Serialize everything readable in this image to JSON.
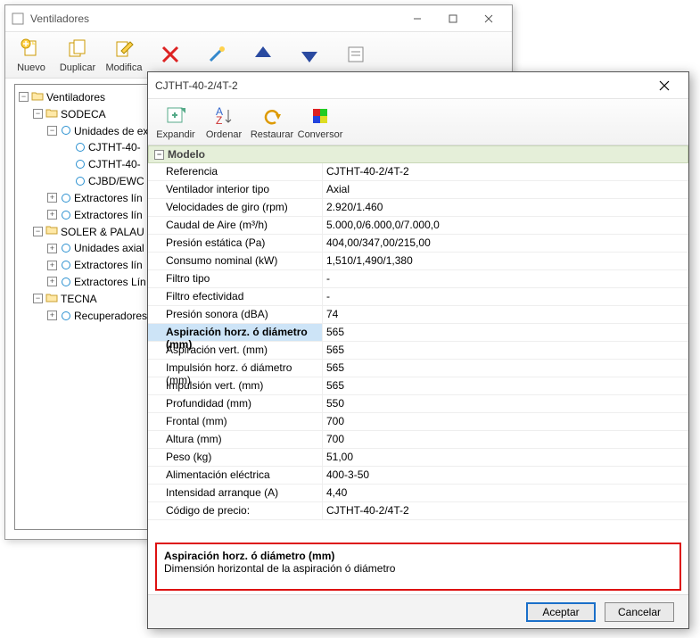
{
  "main_window": {
    "title": "Ventiladores",
    "toolbar": [
      {
        "label": "Nuevo",
        "icon": "new"
      },
      {
        "label": "Duplicar",
        "icon": "duplicate"
      },
      {
        "label": "Modifica",
        "icon": "edit"
      },
      {
        "label": "",
        "icon": "delete"
      },
      {
        "label": "",
        "icon": "wizard"
      },
      {
        "label": "",
        "icon": "up"
      },
      {
        "label": "",
        "icon": "down"
      },
      {
        "label": "",
        "icon": "form"
      }
    ]
  },
  "tree": {
    "root": "Ventiladores",
    "nodes": [
      {
        "label": "SODECA",
        "expanded": true,
        "children": [
          {
            "label": "Unidades de ex",
            "expanded": true,
            "circle": true,
            "children": [
              {
                "label": "CJTHT-40-",
                "circle": true
              },
              {
                "label": "CJTHT-40-",
                "circle": true
              },
              {
                "label": "CJBD/EWC",
                "circle": true
              }
            ]
          },
          {
            "label": "Extractores lín",
            "circle": true,
            "expandable": true
          },
          {
            "label": "Extractores lín",
            "circle": true,
            "expandable": true
          }
        ]
      },
      {
        "label": "SOLER & PALAU",
        "expanded": true,
        "children": [
          {
            "label": "Unidades axial",
            "circle": true,
            "expandable": true
          },
          {
            "label": "Extractores lín",
            "circle": true,
            "expandable": true
          },
          {
            "label": "Extractores Lín",
            "circle": true,
            "expandable": true
          }
        ]
      },
      {
        "label": "TECNA",
        "expanded": true,
        "children": [
          {
            "label": "Recuperadores",
            "circle": true,
            "expandable": true
          }
        ]
      }
    ]
  },
  "dialog": {
    "title": "CJTHT-40-2/4T-2",
    "toolbar": [
      {
        "label": "Expandir",
        "icon": "expand"
      },
      {
        "label": "Ordenar",
        "icon": "sort"
      },
      {
        "label": "Restaurar",
        "icon": "undo"
      },
      {
        "label": "Conversor",
        "icon": "convert"
      }
    ],
    "group": "Modelo",
    "rows": [
      {
        "label": "Referencia",
        "value": "CJTHT-40-2/4T-2"
      },
      {
        "label": "Ventilador interior tipo",
        "value": "Axial"
      },
      {
        "label": "Velocidades de giro (rpm)",
        "value": "2.920/1.460"
      },
      {
        "label": "Caudal de Aire (m³/h)",
        "value": "5.000,0/6.000,0/7.000,0"
      },
      {
        "label": "Presión estática (Pa)",
        "value": "404,00/347,00/215,00"
      },
      {
        "label": "Consumo nominal (kW)",
        "value": "1,510/1,490/1,380"
      },
      {
        "label": "Filtro tipo",
        "value": "-"
      },
      {
        "label": "Filtro efectividad",
        "value": "-"
      },
      {
        "label": "Presión sonora (dBA)",
        "value": "74"
      },
      {
        "label": "Aspiración horz. ó diámetro (mm)",
        "value": "565",
        "selected": true
      },
      {
        "label": "Aspiración vert. (mm)",
        "value": "565"
      },
      {
        "label": "Impulsión horz. ó diámetro (mm)",
        "value": "565"
      },
      {
        "label": "Impulsión vert. (mm)",
        "value": "565"
      },
      {
        "label": "Profundidad (mm)",
        "value": "550"
      },
      {
        "label": "Frontal (mm)",
        "value": "700"
      },
      {
        "label": "Altura (mm)",
        "value": "700"
      },
      {
        "label": "Peso (kg)",
        "value": "51,00"
      },
      {
        "label": "Alimentación eléctrica",
        "value": "400-3-50"
      },
      {
        "label": "Intensidad arranque (A)",
        "value": "4,40"
      },
      {
        "label": "Código de precio:",
        "value": "CJTHT-40-2/4T-2"
      }
    ],
    "help": {
      "title": "Aspiración horz. ó diámetro (mm)",
      "desc": "Dimensión horizontal de la aspiración ó diámetro"
    },
    "buttons": {
      "accept": "Aceptar",
      "cancel": "Cancelar"
    }
  }
}
